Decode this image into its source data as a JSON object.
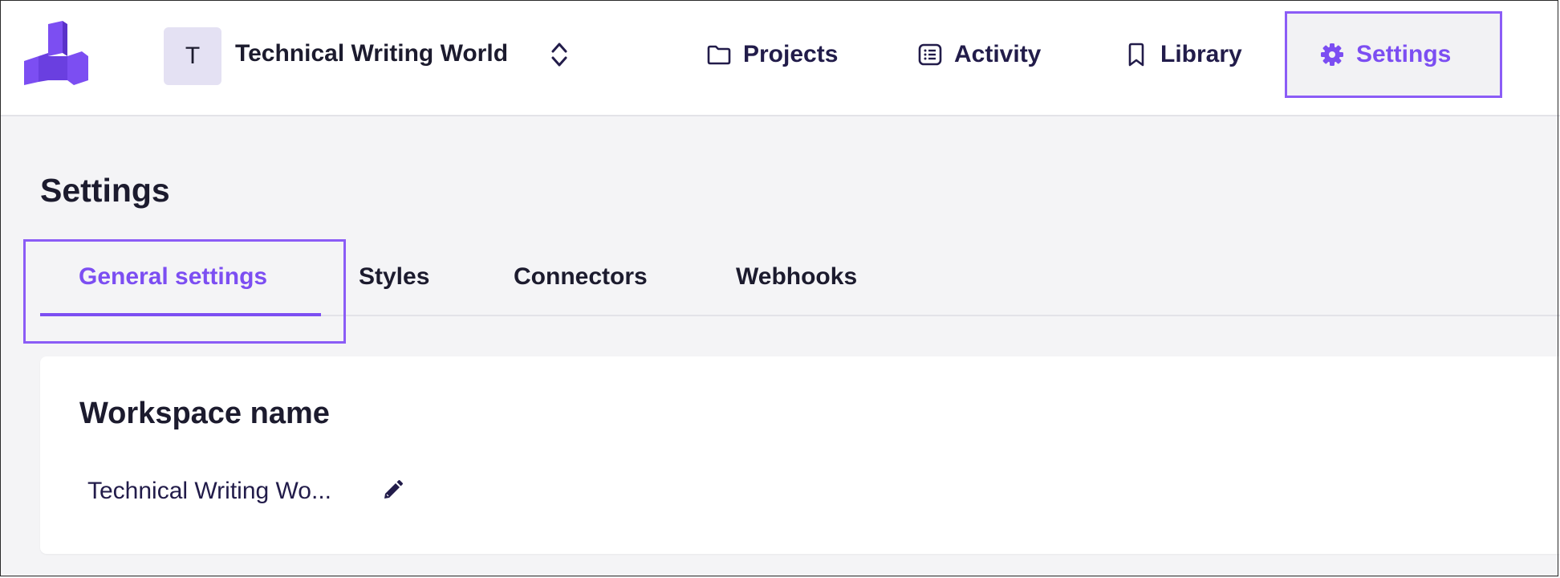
{
  "workspace": {
    "avatar_letter": "T",
    "name": "Technical Writing World"
  },
  "nav": {
    "items": [
      {
        "label": "Projects",
        "icon": "folder-icon"
      },
      {
        "label": "Activity",
        "icon": "activity-list-icon"
      },
      {
        "label": "Library",
        "icon": "bookmark-icon"
      },
      {
        "label": "Settings",
        "icon": "gear-icon",
        "active": true
      }
    ]
  },
  "page": {
    "title": "Settings",
    "tabs": [
      {
        "label": "General settings",
        "active": true
      },
      {
        "label": "Styles"
      },
      {
        "label": "Connectors"
      },
      {
        "label": "Webhooks"
      }
    ]
  },
  "workspace_card": {
    "title": "Workspace name",
    "value": "Technical Writing Wo..."
  },
  "colors": {
    "accent": "#7c4ef2",
    "highlight_border": "#8b5cf6",
    "text_dark": "#1c1b2e",
    "background": "#f4f4f6"
  }
}
